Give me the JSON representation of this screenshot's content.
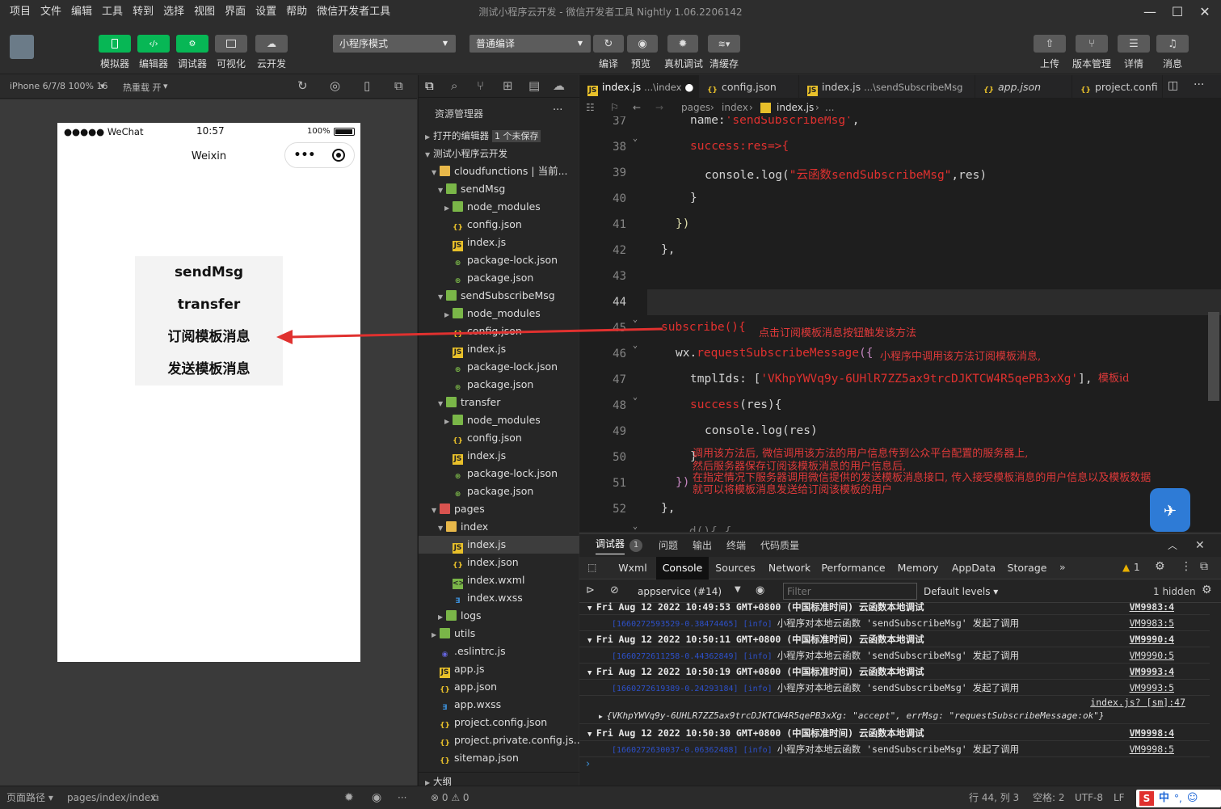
{
  "window": {
    "title": "测试小程序云开发 - 微信开发者工具 Nightly 1.06.2206142",
    "menu": [
      "项目",
      "文件",
      "编辑",
      "工具",
      "转到",
      "选择",
      "视图",
      "界面",
      "设置",
      "帮助",
      "微信开发者工具"
    ]
  },
  "toolbar": {
    "left_buttons": [
      "模拟器",
      "编辑器",
      "调试器",
      "可视化",
      "云开发"
    ],
    "mode_select": "小程序模式",
    "compile_select": "普通编译",
    "mid_buttons": [
      "编译",
      "预览",
      "真机调试",
      "清缓存"
    ],
    "right_buttons": [
      "上传",
      "版本管理",
      "详情",
      "消息"
    ]
  },
  "simulator": {
    "device": "iPhone 6/7/8 100% 16",
    "hot_reload": "热重载 开",
    "status_carrier": "●●●●● WeChat",
    "status_time": "10:57",
    "status_battery": "100%",
    "nav_title": "Weixin",
    "buttons": [
      "sendMsg",
      "transfer",
      "订阅模板消息",
      "发送模板消息"
    ]
  },
  "explorer": {
    "title": "资源管理器",
    "open_editors": "打开的编辑器",
    "unsaved_badge": "1 个未保存",
    "project": "测试小程序云开发",
    "outline": "大纲",
    "tree": [
      {
        "label": "cloudfunctions | 当前...",
        "icon": "folder-open",
        "indent": 1,
        "twisty": "open"
      },
      {
        "label": "sendMsg",
        "icon": "folder-cloud",
        "indent": 2,
        "twisty": "open"
      },
      {
        "label": "node_modules",
        "icon": "folder-green",
        "indent": 3,
        "twisty": "closed"
      },
      {
        "label": "config.json",
        "icon": "json",
        "indent": 3,
        "twisty": ""
      },
      {
        "label": "index.js",
        "icon": "js",
        "indent": 3,
        "twisty": ""
      },
      {
        "label": "package-lock.json",
        "icon": "pkg",
        "indent": 3,
        "twisty": ""
      },
      {
        "label": "package.json",
        "icon": "pkg",
        "indent": 3,
        "twisty": ""
      },
      {
        "label": "sendSubscribeMsg",
        "icon": "folder-cloud",
        "indent": 2,
        "twisty": "open"
      },
      {
        "label": "node_modules",
        "icon": "folder-green",
        "indent": 3,
        "twisty": "closed"
      },
      {
        "label": "config.json",
        "icon": "json",
        "indent": 3,
        "twisty": ""
      },
      {
        "label": "index.js",
        "icon": "js",
        "indent": 3,
        "twisty": ""
      },
      {
        "label": "package-lock.json",
        "icon": "pkg",
        "indent": 3,
        "twisty": ""
      },
      {
        "label": "package.json",
        "icon": "pkg",
        "indent": 3,
        "twisty": ""
      },
      {
        "label": "transfer",
        "icon": "folder-cloud",
        "indent": 2,
        "twisty": "open"
      },
      {
        "label": "node_modules",
        "icon": "folder-green",
        "indent": 3,
        "twisty": "closed"
      },
      {
        "label": "config.json",
        "icon": "json",
        "indent": 3,
        "twisty": ""
      },
      {
        "label": "index.js",
        "icon": "js",
        "indent": 3,
        "twisty": ""
      },
      {
        "label": "package-lock.json",
        "icon": "pkg",
        "indent": 3,
        "twisty": ""
      },
      {
        "label": "package.json",
        "icon": "pkg",
        "indent": 3,
        "twisty": ""
      },
      {
        "label": "pages",
        "icon": "folder-red",
        "indent": 1,
        "twisty": "open"
      },
      {
        "label": "index",
        "icon": "folder-open",
        "indent": 2,
        "twisty": "open"
      },
      {
        "label": "index.js",
        "icon": "js",
        "indent": 3,
        "twisty": "",
        "selected": true
      },
      {
        "label": "index.json",
        "icon": "json",
        "indent": 3,
        "twisty": ""
      },
      {
        "label": "index.wxml",
        "icon": "wxml",
        "indent": 3,
        "twisty": ""
      },
      {
        "label": "index.wxss",
        "icon": "wxss",
        "indent": 3,
        "twisty": ""
      },
      {
        "label": "logs",
        "icon": "folder-green",
        "indent": 2,
        "twisty": "closed"
      },
      {
        "label": "utils",
        "icon": "folder-green",
        "indent": 1,
        "twisty": "closed"
      },
      {
        "label": ".eslintrc.js",
        "icon": "eslint",
        "indent": 1,
        "twisty": ""
      },
      {
        "label": "app.js",
        "icon": "js",
        "indent": 1,
        "twisty": ""
      },
      {
        "label": "app.json",
        "icon": "json",
        "indent": 1,
        "twisty": ""
      },
      {
        "label": "app.wxss",
        "icon": "wxss",
        "indent": 1,
        "twisty": ""
      },
      {
        "label": "project.config.json",
        "icon": "json",
        "indent": 1,
        "twisty": ""
      },
      {
        "label": "project.private.config.js...",
        "icon": "json",
        "indent": 1,
        "twisty": ""
      },
      {
        "label": "sitemap.json",
        "icon": "json",
        "indent": 1,
        "twisty": ""
      }
    ]
  },
  "editor": {
    "tabs": [
      {
        "label": "index.js",
        "desc": "...\\index",
        "dot": "●"
      },
      {
        "label": "config.json",
        "desc": ""
      },
      {
        "label": "index.js",
        "desc": "...\\sendSubscribeMsg"
      },
      {
        "label": "app.json",
        "desc": ""
      },
      {
        "label": "project.confi",
        "desc": ""
      }
    ],
    "breadcrumb": [
      "pages",
      "index",
      "index.js",
      "..."
    ],
    "line_numbers": [
      "37",
      "38",
      "39",
      "40",
      "41",
      "42",
      "43",
      "44",
      "45",
      "46",
      "47",
      "48",
      "49",
      "50",
      "51",
      "52"
    ],
    "code": {
      "l37": [
        "name:",
        "'sendSubscribeMsg'",
        ","
      ],
      "l38": [
        "success:",
        "res=>{"
      ],
      "l39": [
        "console.log(",
        "\"云函数sendSubscribeMsg\"",
        ",res)"
      ],
      "l40": "}",
      "l41": "})",
      "l42": "},",
      "l45": "subscribe(){",
      "l46": [
        "wx.",
        "requestSubscribeMessage",
        "({"
      ],
      "l47": [
        "tmplIds: [",
        "'VKhpYWVq9y-6UHlR7ZZ5ax9trcDJKTCW4R5qePB3xXg'",
        "],"
      ],
      "l48": [
        "success",
        "(res){"
      ],
      "l49": "console.log(res)",
      "l50": "}",
      "l51": "})",
      "l52": "},",
      "l53": "  ..d(){ {"
    },
    "annotations": {
      "a1": "点击订阅模板消息按钮触发该方法",
      "a2": "小程序中调用该方法订阅模板消息,",
      "a3": "模板id",
      "a4": "调用该方法后, 微信调用该方法的用户信息传到公众平台配置的服务器上,",
      "a5": "然后服务器保存订阅该模板消息的用户信息后,",
      "a6": "在指定情况下服务器调用微信提供的发送模板消息接口, 传入接受模板消息的用户信息以及模板数据",
      "a7": "就可以将模板消息发送给订阅该模板的用户"
    }
  },
  "devtools": {
    "panel_tabs": [
      "调试器",
      "问题",
      "输出",
      "终端",
      "代码质量"
    ],
    "debugger_badge": "1",
    "tabs": [
      "Wxml",
      "Console",
      "Sources",
      "Network",
      "Performance",
      "Memory",
      "AppData",
      "Storage"
    ],
    "warn_count": "1",
    "context": "appservice (#14)",
    "filter_placeholder": "Filter",
    "levels": "Default levels ▾",
    "hidden": "1 hidden",
    "logs": [
      {
        "type": "group",
        "text": "Fri Aug 12 2022 10:49:53 GMT+0800 (中国标准时间) 云函数本地调试",
        "src": "VM9983:4"
      },
      {
        "type": "info",
        "prefix": "[1660272593529-0.38474465] [info]",
        "text": "小程序对本地云函数 'sendSubscribeMsg' 发起了调用",
        "src": "VM9983:5"
      },
      {
        "type": "group",
        "text": "Fri Aug 12 2022 10:50:11 GMT+0800 (中国标准时间) 云函数本地调试",
        "src": "VM9990:4"
      },
      {
        "type": "info",
        "prefix": "[1660272611258-0.44362849] [info]",
        "text": "小程序对本地云函数 'sendSubscribeMsg' 发起了调用",
        "src": "VM9990:5"
      },
      {
        "type": "group",
        "text": "Fri Aug 12 2022 10:50:19 GMT+0800 (中国标准时间) 云函数本地调试",
        "src": "VM9993:4"
      },
      {
        "type": "info",
        "prefix": "[1660272619389-0.24293184] [info]",
        "text": "小程序对本地云函数 'sendSubscribeMsg' 发起了调用",
        "src": "VM9993:5"
      },
      {
        "type": "src",
        "src": "index.js? [sm]:47"
      },
      {
        "type": "obj",
        "text": "{VKhpYWVq9y-6UHLR7ZZ5ax9trcDJKTCW4R5qePB3xXg: \"accept\", errMsg: \"requestSubscribeMessage:ok\"}"
      },
      {
        "type": "group",
        "text": "Fri Aug 12 2022 10:50:30 GMT+0800 (中国标准时间) 云函数本地调试",
        "src": "VM9998:4"
      },
      {
        "type": "info",
        "prefix": "[1660272630037-0.06362488] [info]",
        "text": "小程序对本地云函数 'sendSubscribeMsg' 发起了调用",
        "src": "VM9998:5"
      }
    ]
  },
  "statusbar": {
    "page_path_label": "页面路径 ▾",
    "page_path": "pages/index/index",
    "errors": "⊗ 0 ⚠ 0",
    "cursor": "行 44, 列 3",
    "indent": "空格: 2",
    "encoding": "UTF-8",
    "eol": "LF",
    "ime": "中"
  },
  "colors": {
    "accent_green": "#07b755",
    "annotation_red": "#e0312f"
  }
}
